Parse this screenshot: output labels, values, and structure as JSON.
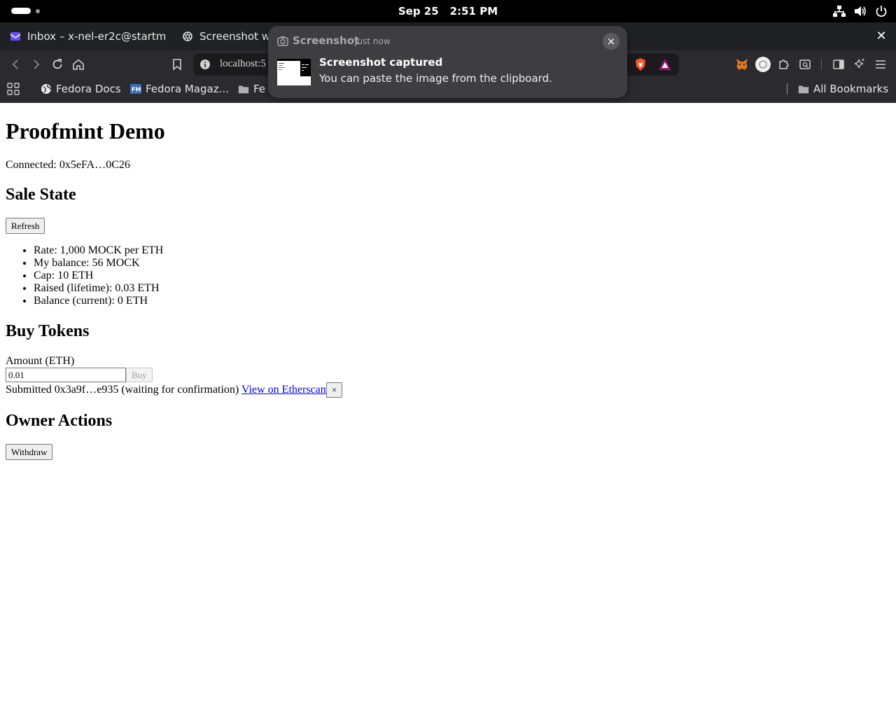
{
  "system_bar": {
    "date": "Sep 25",
    "time": "2:51 PM",
    "icons": [
      "network-icon",
      "volume-icon",
      "power-icon"
    ]
  },
  "browser": {
    "tabs": [
      {
        "label": "Inbox – x-nel-er2c@startma",
        "icon": "mail-icon"
      },
      {
        "label": "Screenshot w",
        "icon": "openai-icon"
      }
    ],
    "url": "localhost:5",
    "bookmarks": [
      {
        "label": "Fedora Docs",
        "icon": "globe-icon"
      },
      {
        "label": "Fedora Magaz...",
        "icon": "fedora-magazine-icon"
      },
      {
        "label": "Fe",
        "icon": "folder-icon"
      }
    ],
    "all_bookmarks_label": "All Bookmarks"
  },
  "notification": {
    "app": "Screenshot",
    "time": "Just now",
    "title": "Screenshot captured",
    "body": "You can paste the image from the clipboard.",
    "close_label": "×"
  },
  "page": {
    "title": "Proofmint Demo",
    "connected": "Connected: 0x5eFA…0C26",
    "sale_state": {
      "heading": "Sale State",
      "refresh_label": "Refresh",
      "stats": [
        "Rate: 1,000 MOCK per ETH",
        "My balance: 56 MOCK",
        "Cap: 10 ETH",
        "Raised (lifetime): 0.03 ETH",
        "Balance (current): 0 ETH"
      ]
    },
    "buy": {
      "heading": "Buy Tokens",
      "amount_label": "Amount (ETH)",
      "amount_value": "0.01",
      "buy_label": "Buy",
      "submitted_text": "Submitted 0x3a9f…e935 (waiting for confirmation) ",
      "etherscan_link": "View on Etherscan",
      "dismiss_label": "×"
    },
    "owner": {
      "heading": "Owner Actions",
      "withdraw_label": "Withdraw"
    }
  }
}
